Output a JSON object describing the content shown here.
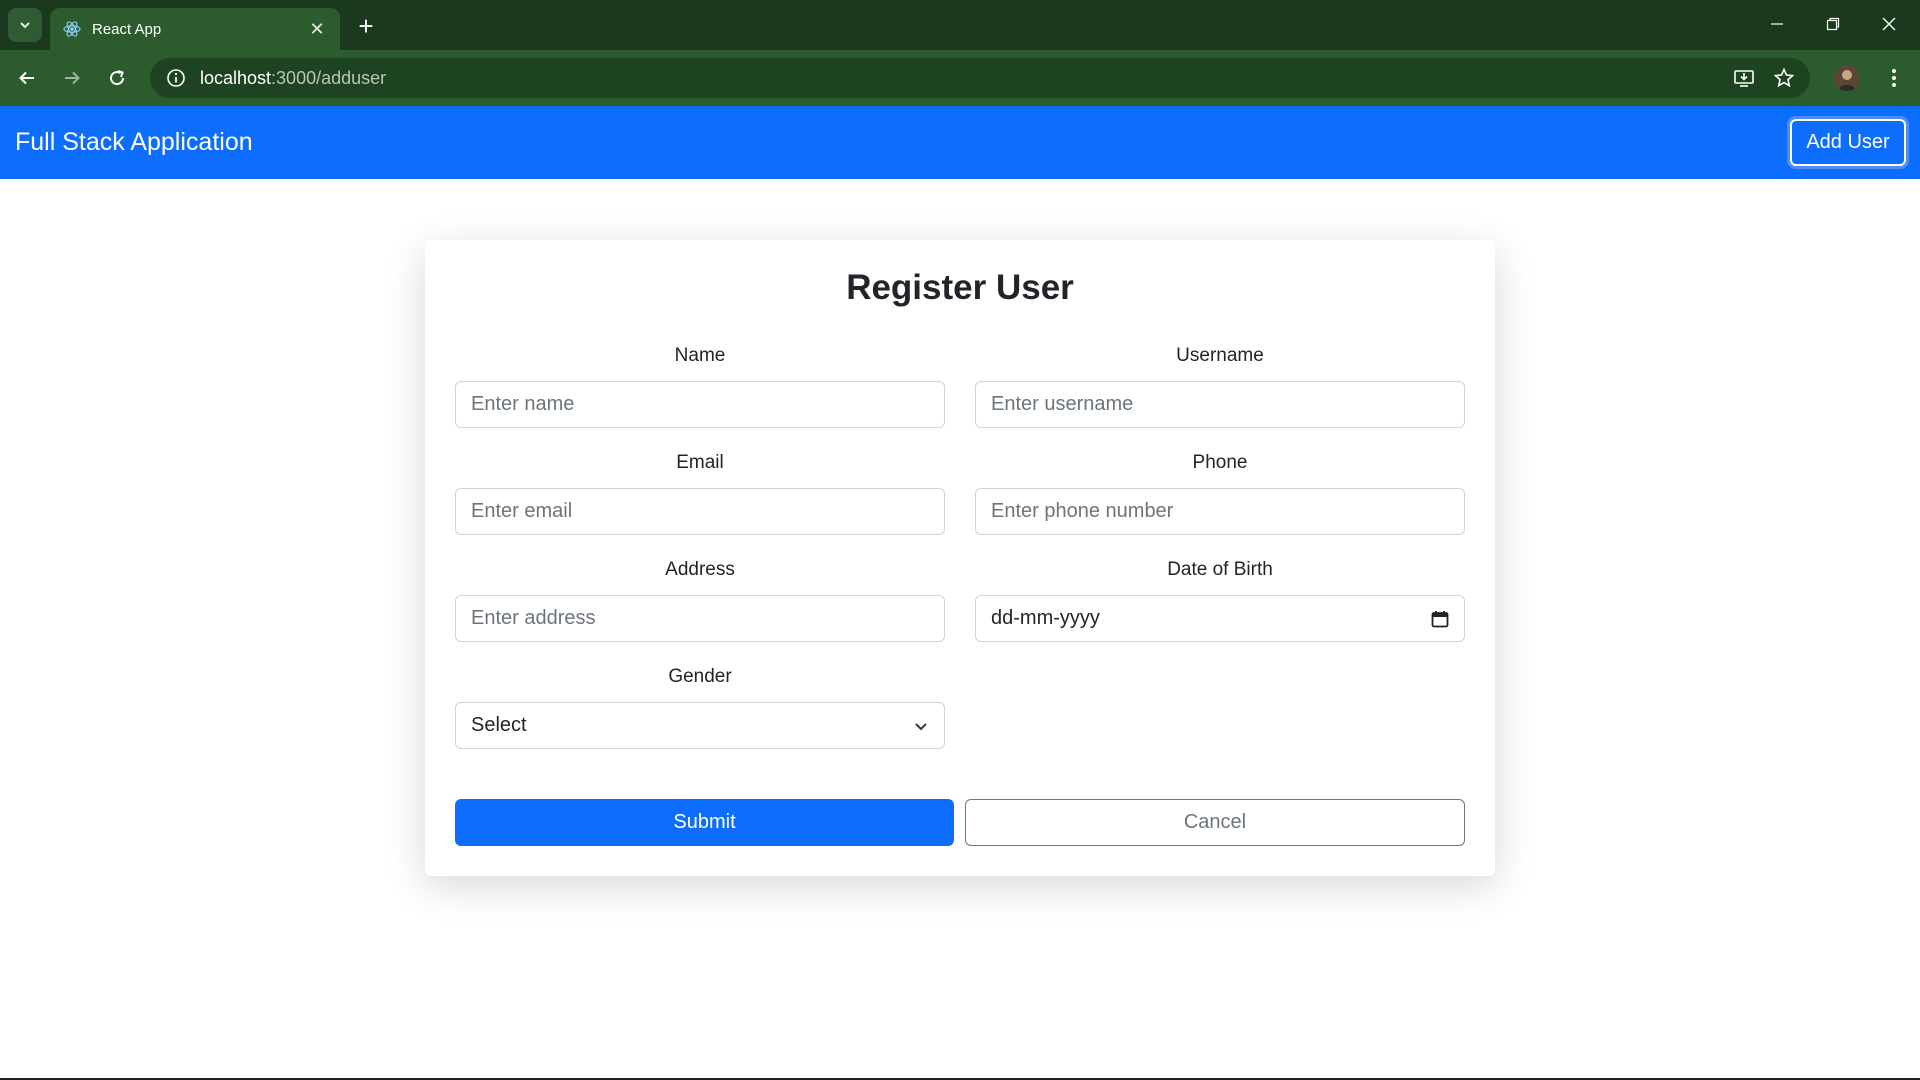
{
  "browser": {
    "tab_title": "React App",
    "url_host": "localhost",
    "url_path": ":3000/adduser"
  },
  "navbar": {
    "brand": "Full Stack Application",
    "add_user_label": "Add User"
  },
  "form": {
    "title": "Register User",
    "name": {
      "label": "Name",
      "placeholder": "Enter name",
      "value": ""
    },
    "username": {
      "label": "Username",
      "placeholder": "Enter username",
      "value": ""
    },
    "email": {
      "label": "Email",
      "placeholder": "Enter email",
      "value": ""
    },
    "phone": {
      "label": "Phone",
      "placeholder": "Enter phone number",
      "value": ""
    },
    "address": {
      "label": "Address",
      "placeholder": "Enter address",
      "value": ""
    },
    "dob": {
      "label": "Date of Birth",
      "value": "dd-mm-yyyy"
    },
    "gender": {
      "label": "Gender",
      "selected": "Select"
    },
    "submit_label": "Submit",
    "cancel_label": "Cancel"
  },
  "colors": {
    "primary": "#0d6efd",
    "browser_frame": "#2c5b2e",
    "muted": "#6c757d"
  },
  "icons": {
    "tab_search": "chevron-down-icon",
    "favicon": "react-icon",
    "tab_close": "close-icon",
    "new_tab": "plus-icon",
    "back": "arrow-left-icon",
    "forward": "arrow-right-icon",
    "reload": "reload-icon",
    "site_info": "info-icon",
    "install": "install-app-icon",
    "bookmark": "star-icon",
    "menu": "kebab-menu-icon",
    "calendar": "calendar-icon",
    "select": "chevron-down-icon"
  }
}
